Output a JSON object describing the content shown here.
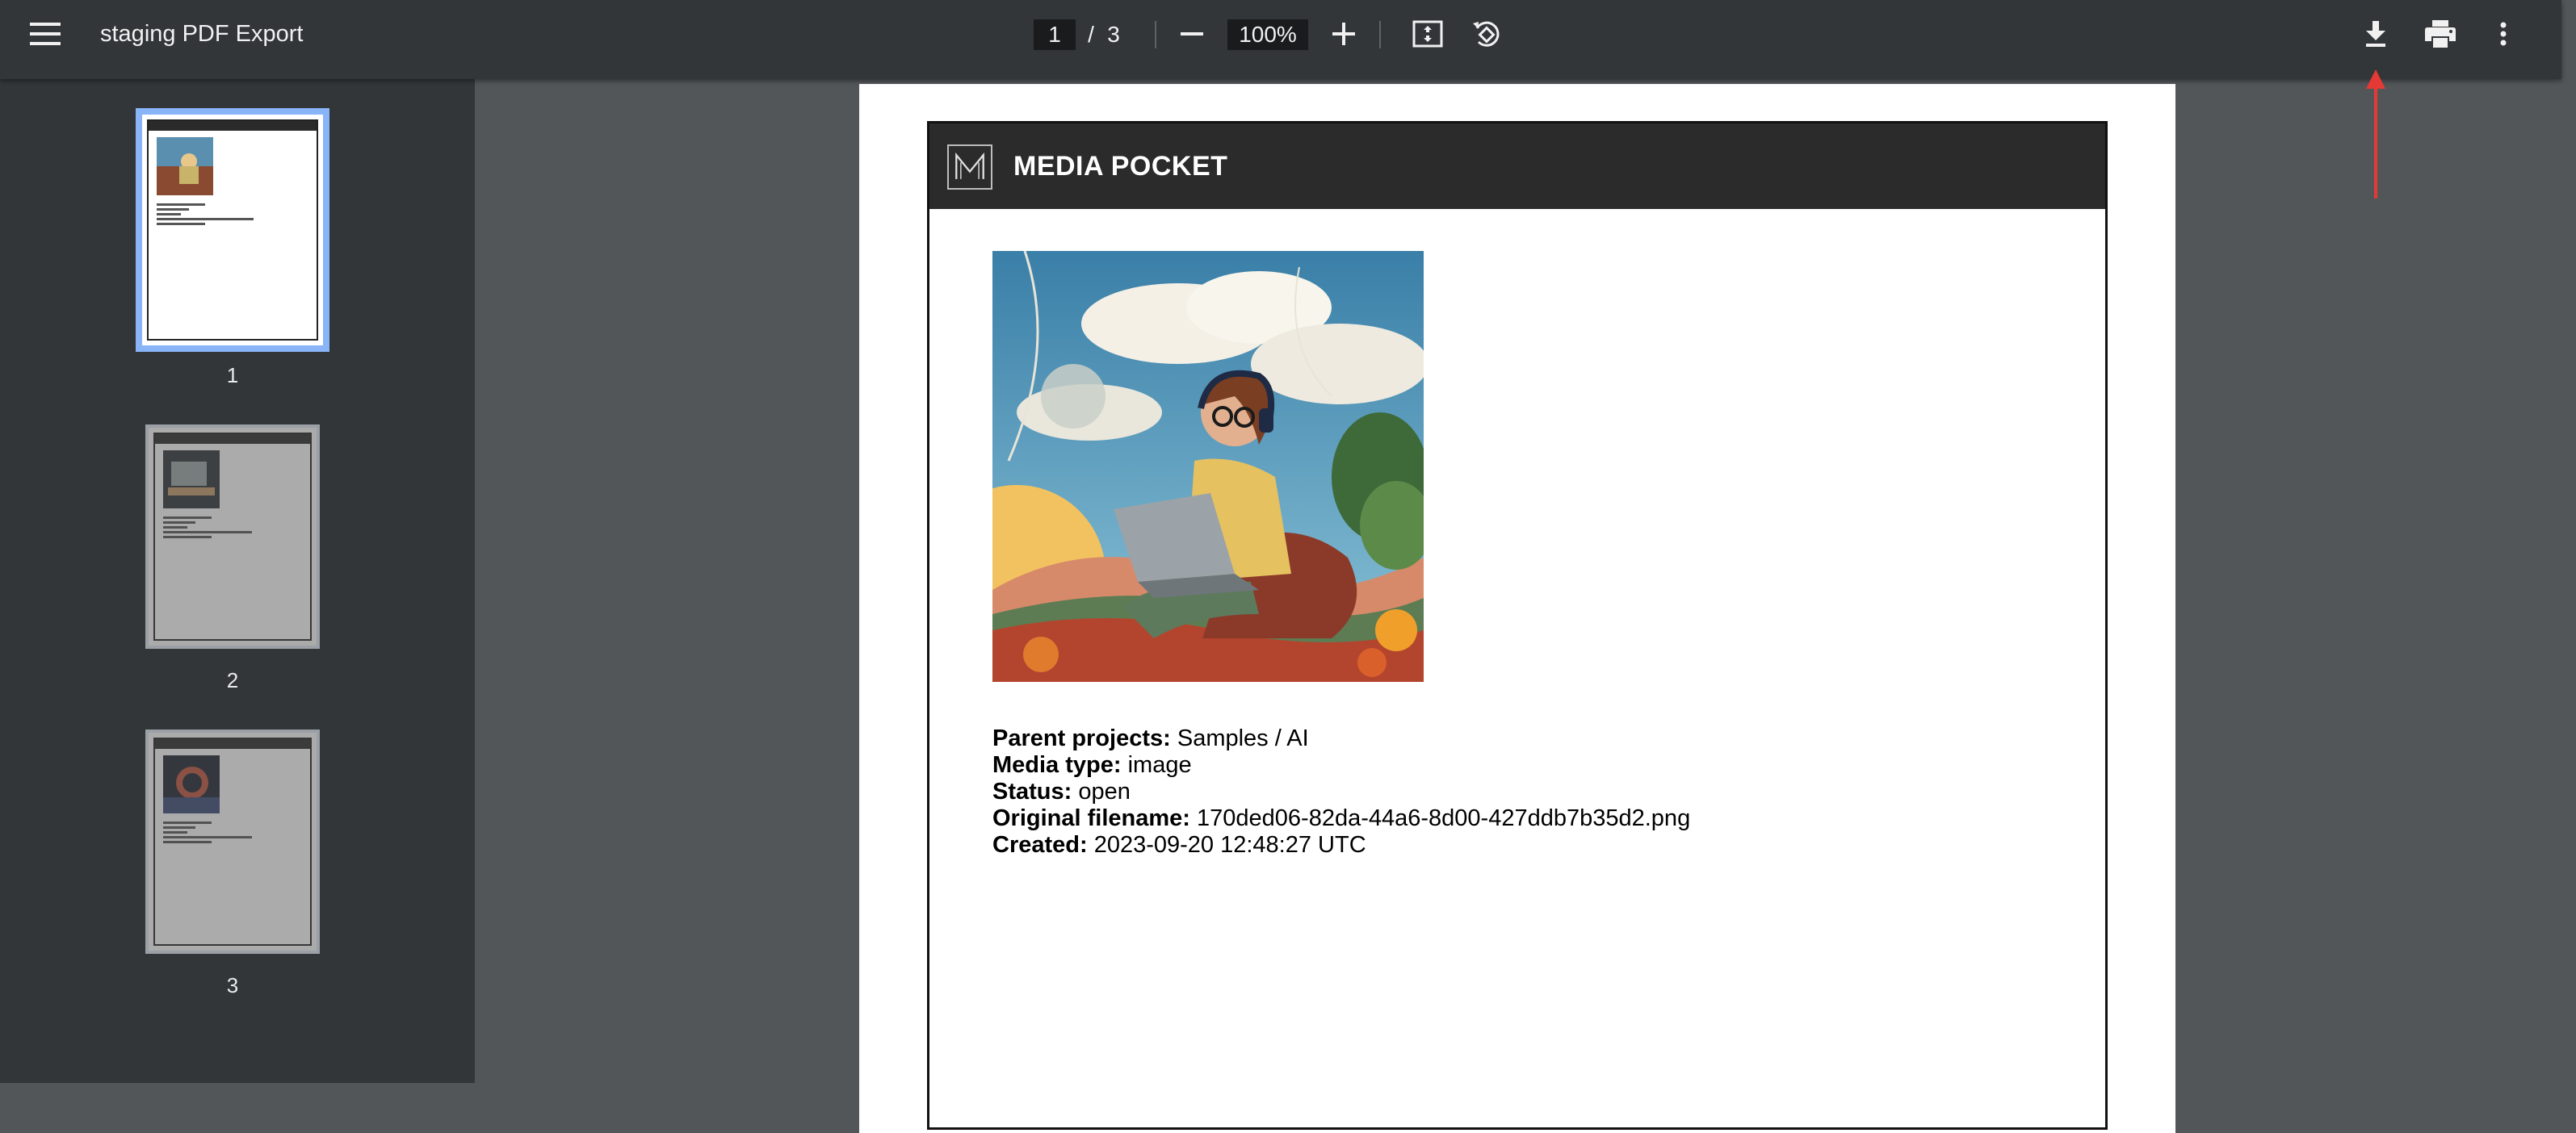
{
  "toolbar": {
    "title": "staging PDF Export",
    "current_page": "1",
    "page_separator": "/",
    "total_pages": "3",
    "zoom": "100%",
    "icons": {
      "menu": "hamburger-menu-icon",
      "zoom_out": "minus-icon",
      "zoom_in": "plus-icon",
      "fit": "fit-to-page-icon",
      "rotate": "rotate-counterclockwise-icon",
      "download": "download-icon",
      "print": "print-icon",
      "more": "more-vertical-icon"
    }
  },
  "sidebar": {
    "thumbnails": [
      {
        "label": "1",
        "active": true
      },
      {
        "label": "2",
        "active": false
      },
      {
        "label": "3",
        "active": false
      }
    ]
  },
  "document": {
    "brand": "MEDIA POCKET",
    "fields": [
      {
        "label": "Parent projects:",
        "value": " Samples / AI"
      },
      {
        "label": "Media type:",
        "value": " image"
      },
      {
        "label": "Status:",
        "value": " open"
      },
      {
        "label": "Original filename:",
        "value": " 170ded06-82da-44a6-8d00-427ddb7b35d2.png"
      },
      {
        "label": "Created:",
        "value": " 2023-09-20 12:48:27 UTC"
      }
    ]
  },
  "colors": {
    "toolbar_bg": "#323639",
    "viewer_bg": "#525659",
    "active_thumb_border": "#8ab4f8",
    "annotation_arrow": "#e53935",
    "doc_header_bg": "#2b2b2b"
  }
}
